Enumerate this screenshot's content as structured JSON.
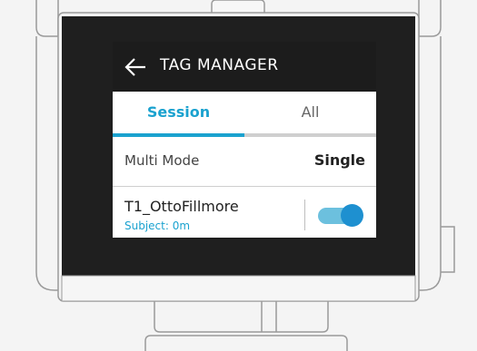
{
  "header": {
    "title": "TAG MANAGER",
    "back_icon": "arrow-left-icon"
  },
  "tabs": [
    {
      "label": "Session",
      "active": true
    },
    {
      "label": "All",
      "active": false
    }
  ],
  "multi_mode": {
    "label": "Multi Mode",
    "value": "Single"
  },
  "tag": {
    "name": "T1_OttoFillmore",
    "subtitle": "Subject: 0m",
    "enabled": true
  },
  "colors": {
    "accent": "#1ba2cf",
    "header_bg": "#1c1c1c",
    "toggle_track": "#6cc0de",
    "toggle_knob": "#1e90d0"
  }
}
